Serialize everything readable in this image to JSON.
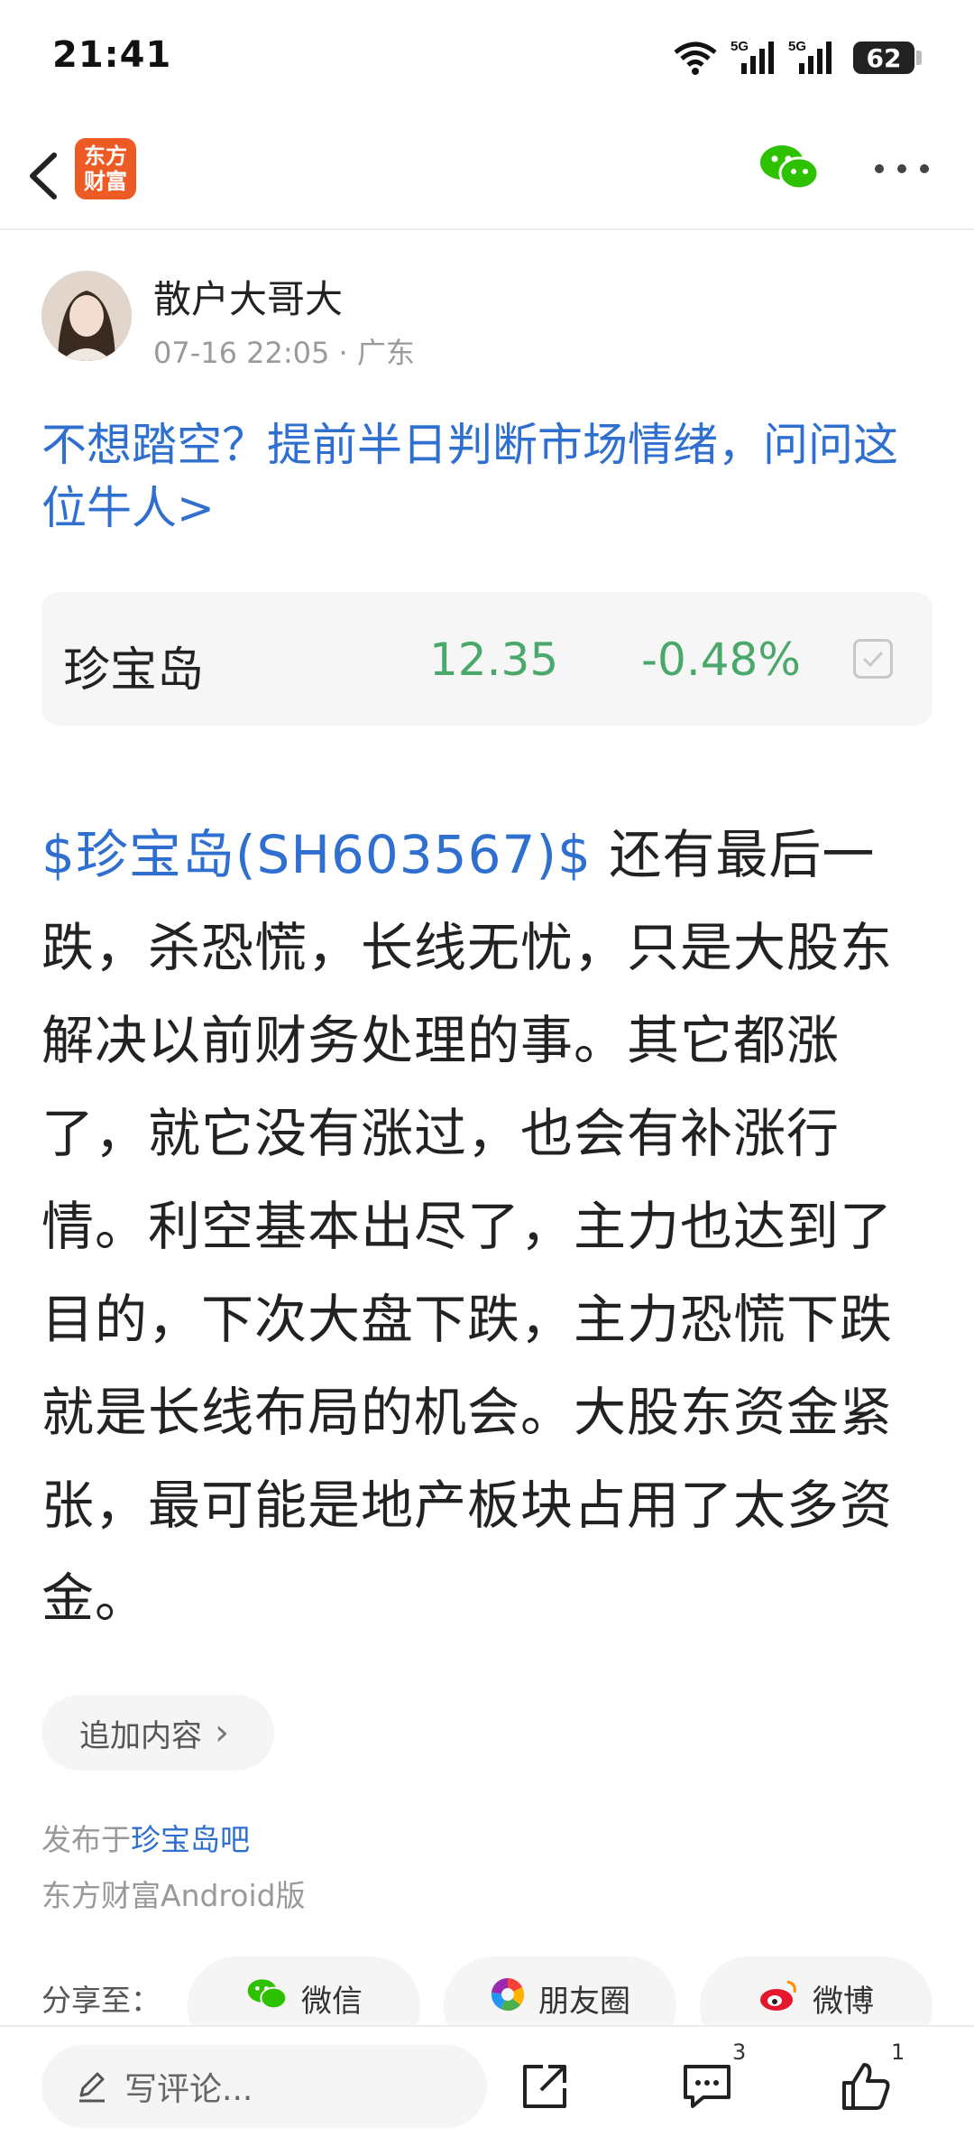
{
  "status_bar": {
    "time": "21:41",
    "battery": "62"
  },
  "nav": {
    "logo_line1": "东方",
    "logo_line2": "财富"
  },
  "author": {
    "name": "散户大哥大",
    "meta": "07-16 22:05 · 广东"
  },
  "promo": {
    "text": "不想踏空？提前半日判断市场情绪，问问这位牛人>"
  },
  "stock_card": {
    "name": "珍宝岛",
    "price": "12.35",
    "change": "-0.48%"
  },
  "post": {
    "stock_link": "$珍宝岛(SH603567)$",
    "text": " 还有最后一跌，杀恐慌，长线无忧，只是大股东解决以前财务处理的事。其它都涨了，就它没有涨过，也会有补涨行情。利空基本出尽了，主力也达到了目的，下次大盘下跌，主力恐慌下跌就是长线布局的机会。大股东资金紧张，最可能是地产板块占用了太多资金。"
  },
  "append": {
    "label": "追加内容",
    "chevron": "›"
  },
  "posted_in": {
    "prefix": "发布于",
    "bar": "珍宝岛吧"
  },
  "client": "东方财富Android版",
  "share": {
    "label": "分享至：",
    "buttons": [
      {
        "label": "微信",
        "icon": "wechat-icon"
      },
      {
        "label": "朋友圈",
        "icon": "moments-icon"
      },
      {
        "label": "微博",
        "icon": "weibo-icon"
      }
    ]
  },
  "bottom_bar": {
    "comment_placeholder": "写评论...",
    "comment_count": "3",
    "like_count": "1"
  },
  "colors": {
    "link_blue": "#2e6fcf",
    "stock_green": "#4aa86a",
    "logo_orange": "#ee5a24",
    "wechat_green": "#2dc100"
  }
}
